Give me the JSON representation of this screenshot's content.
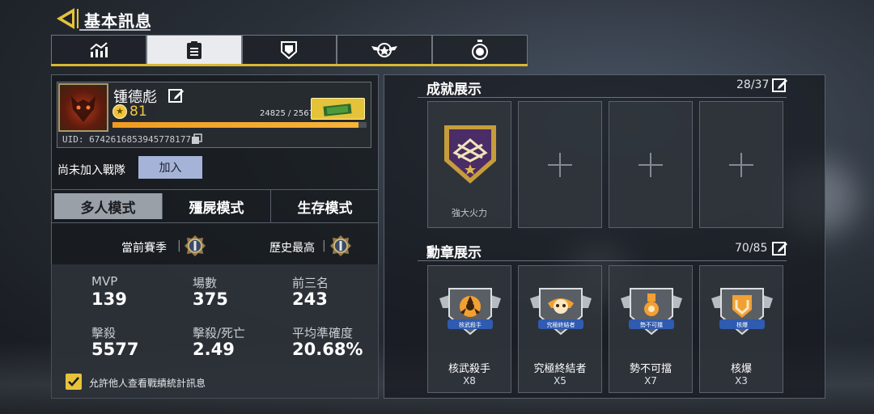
{
  "header": {
    "title": "基本訊息"
  },
  "tabs": [
    {
      "icon": "trend-chart-icon",
      "active": false
    },
    {
      "icon": "clipboard-icon",
      "active": true
    },
    {
      "icon": "emblem-icon",
      "active": false
    },
    {
      "icon": "winged-badge-icon",
      "active": false
    },
    {
      "icon": "stopwatch-icon",
      "active": false
    }
  ],
  "profile": {
    "name": "锺德彪",
    "level": "81",
    "xp_text": "24825 / 25670",
    "xp_progress": 0.967,
    "uid": "UID: 6742616853945778177"
  },
  "clan": {
    "label": "尚未加入戰隊",
    "join_label": "加入"
  },
  "modes": {
    "multiplayer": "多人模式",
    "zombies": "殭屍模式",
    "survival": "生存模式"
  },
  "season": {
    "current_label": "當前賽季",
    "best_label": "歷史最高"
  },
  "stats": {
    "mvp_label": "MVP",
    "mvp_value": "139",
    "matches_label": "場數",
    "matches_value": "375",
    "top3_label": "前三名",
    "top3_value": "243",
    "kills_label": "擊殺",
    "kills_value": "5577",
    "kd_label": "擊殺/死亡",
    "kd_value": "2.49",
    "accuracy_label": "平均準確度",
    "accuracy_value": "20.68%"
  },
  "privacy": {
    "label": "允許他人查看戰績統計訊息",
    "checked": true
  },
  "achievements": {
    "title": "成就展示",
    "count": "28/37",
    "items": [
      {
        "caption": "強大火力"
      }
    ]
  },
  "medals": {
    "title": "勳章展示",
    "count": "70/85",
    "items": [
      {
        "name": "核武殺手",
        "banner": "核武殺手",
        "count": "X8"
      },
      {
        "name": "究極終結者",
        "banner": "究極終結者",
        "count": "X5"
      },
      {
        "name": "勢不可擋",
        "banner": "勢不可擋",
        "count": "X7"
      },
      {
        "name": "核爆",
        "banner": "核爆",
        "count": "X3"
      }
    ]
  },
  "colors": {
    "accent": "#e4c33b",
    "xp_bar": "#f09a22",
    "join_button": "#a6b3d8"
  }
}
